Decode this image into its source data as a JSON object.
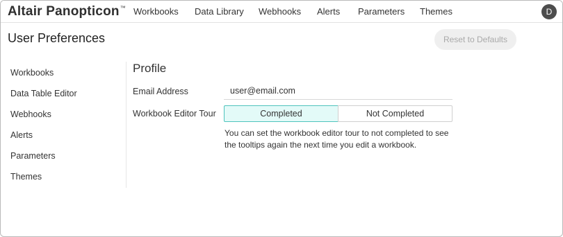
{
  "app": {
    "logo_text": "Altair Panopticon",
    "logo_tm": "™"
  },
  "nav": {
    "items": [
      {
        "label": "Workbooks"
      },
      {
        "label": "Data Library"
      },
      {
        "label": "Webhooks"
      },
      {
        "label": "Alerts"
      },
      {
        "label": "Parameters"
      },
      {
        "label": "Themes"
      }
    ]
  },
  "user": {
    "initial": "D"
  },
  "page": {
    "title": "User Preferences",
    "reset_label": "Reset to Defaults"
  },
  "sidebar": {
    "items": [
      {
        "label": "Workbooks"
      },
      {
        "label": "Data Table Editor"
      },
      {
        "label": "Webhooks"
      },
      {
        "label": "Alerts"
      },
      {
        "label": "Parameters"
      },
      {
        "label": "Themes"
      }
    ]
  },
  "profile": {
    "title": "Profile",
    "email_label": "Email Address",
    "email_value": "user@email.com",
    "tour_label": "Workbook Editor Tour",
    "tour_options": [
      "Completed",
      "Not Completed"
    ],
    "tour_selected": "Completed",
    "tour_help": "You can set the workbook editor tour to not completed to see the tooltips again the next time you edit a workbook."
  },
  "colors": {
    "accent_border": "#4dc3bd",
    "accent_fill": "#e3faf8",
    "avatar": "#4d4d4d"
  }
}
